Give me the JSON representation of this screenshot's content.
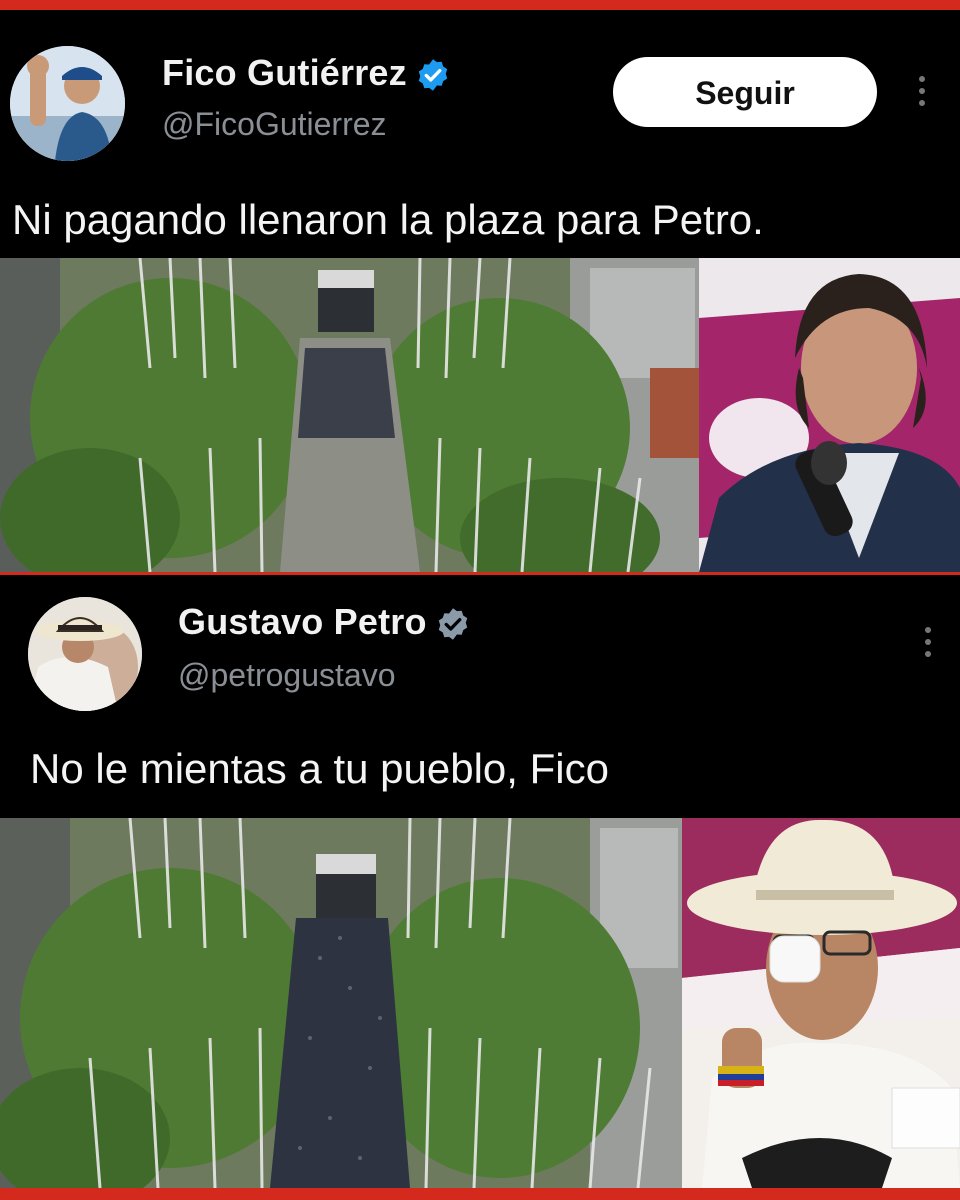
{
  "tweets": [
    {
      "author_name": "Fico Gutiérrez",
      "handle": "@FicoGutierrez",
      "verified_icon": "verified-badge-icon",
      "follow_label": "Seguir",
      "text": "Ni pagando llenaron la plaza para Petro.",
      "media": [
        "aerial-plaza-photo-sparse-crowd",
        "fico-portrait-photo"
      ]
    },
    {
      "author_name": "Gustavo Petro",
      "handle": "@petrogustavo",
      "verified_icon": "verified-badge-icon",
      "text": "No le mientas a tu pueblo, Fico",
      "media": [
        "aerial-plaza-photo-full-crowd",
        "petro-portrait-photo"
      ]
    }
  ],
  "colors": {
    "frame_red": "#d42a1e",
    "verified_blue": "#1d9bf0",
    "verified_gray": "#8a9aa8",
    "background": "#000000"
  }
}
